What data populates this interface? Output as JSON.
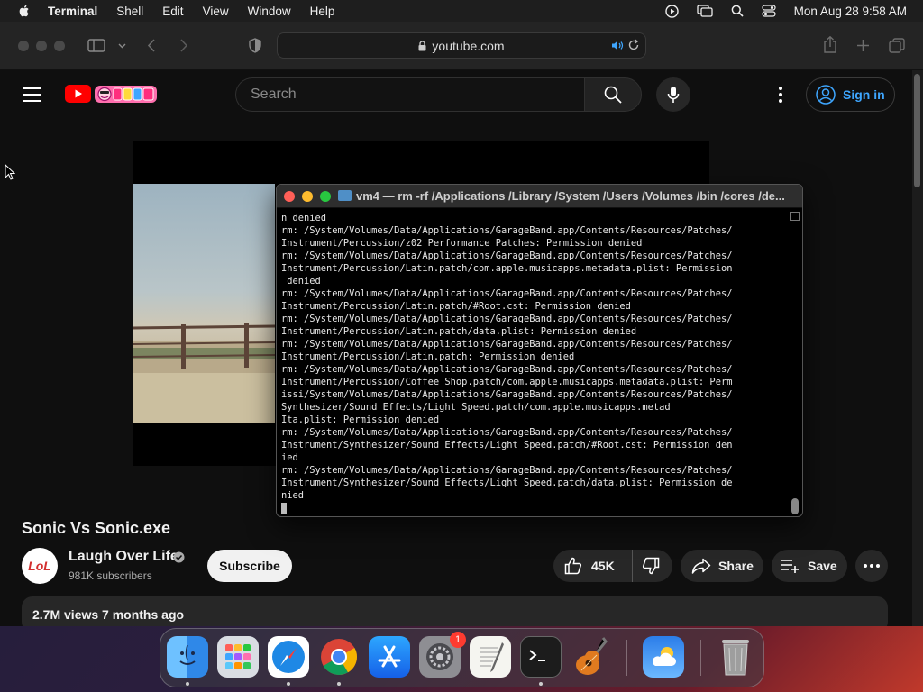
{
  "menubar": {
    "app_name": "Terminal",
    "items": [
      "Shell",
      "Edit",
      "View",
      "Window",
      "Help"
    ],
    "clock": "Mon Aug 28  9:58 AM"
  },
  "browser": {
    "url": "youtube.com"
  },
  "youtube": {
    "search_placeholder": "Search",
    "sign_in": "Sign in",
    "video_title": "Sonic Vs Sonic.exe",
    "channel": {
      "name": "Laugh Over Life",
      "subscribers": "981K subscribers",
      "avatar_text": "LoL"
    },
    "subscribe_label": "Subscribe",
    "likes": "45K",
    "share_label": "Share",
    "save_label": "Save",
    "description_meta": "2.7M views  7 months ago"
  },
  "terminal": {
    "title": "vm4 — rm -rf /Applications /Library /System /Users /Volumes /bin /cores /de...",
    "lines": [
      "n denied",
      "rm: /System/Volumes/Data/Applications/GarageBand.app/Contents/Resources/Patches/",
      "Instrument/Percussion/z02 Performance Patches: Permission denied",
      "rm: /System/Volumes/Data/Applications/GarageBand.app/Contents/Resources/Patches/",
      "Instrument/Percussion/Latin.patch/com.apple.musicapps.metadata.plist: Permission",
      " denied",
      "rm: /System/Volumes/Data/Applications/GarageBand.app/Contents/Resources/Patches/",
      "Instrument/Percussion/Latin.patch/#Root.cst: Permission denied",
      "rm: /System/Volumes/Data/Applications/GarageBand.app/Contents/Resources/Patches/",
      "Instrument/Percussion/Latin.patch/data.plist: Permission denied",
      "rm: /System/Volumes/Data/Applications/GarageBand.app/Contents/Resources/Patches/",
      "Instrument/Percussion/Latin.patch: Permission denied",
      "rm: /System/Volumes/Data/Applications/GarageBand.app/Contents/Resources/Patches/",
      "Instrument/Percussion/Coffee Shop.patch/com.apple.musicapps.metadata.plist: Perm",
      "issi/System/Volumes/Data/Applications/GarageBand.app/Contents/Resources/Patches/",
      "Synthesizer/Sound Effects/Light Speed.patch/com.apple.musicapps.metad",
      "Ita.plist: Permission denied",
      "rm: /System/Volumes/Data/Applications/GarageBand.app/Contents/Resources/Patches/",
      "Instrument/Synthesizer/Sound Effects/Light Speed.patch/#Root.cst: Permission den",
      "ied",
      "rm: /System/Volumes/Data/Applications/GarageBand.app/Contents/Resources/Patches/",
      "Instrument/Synthesizer/Sound Effects/Light Speed.patch/data.plist: Permission de",
      "nied"
    ]
  },
  "dock": {
    "apps": [
      "finder-icon",
      "launchpad-icon",
      "safari-icon",
      "chrome-icon",
      "app-store-icon",
      "system-settings-icon",
      "textedit-icon",
      "terminal-icon",
      "garageband-icon",
      "weather-icon",
      "trash-icon"
    ],
    "settings_badge": "1"
  },
  "colors": {
    "yt_red": "#ff0000",
    "link_blue": "#3ea6ff",
    "bg": "#0f0f0f"
  }
}
